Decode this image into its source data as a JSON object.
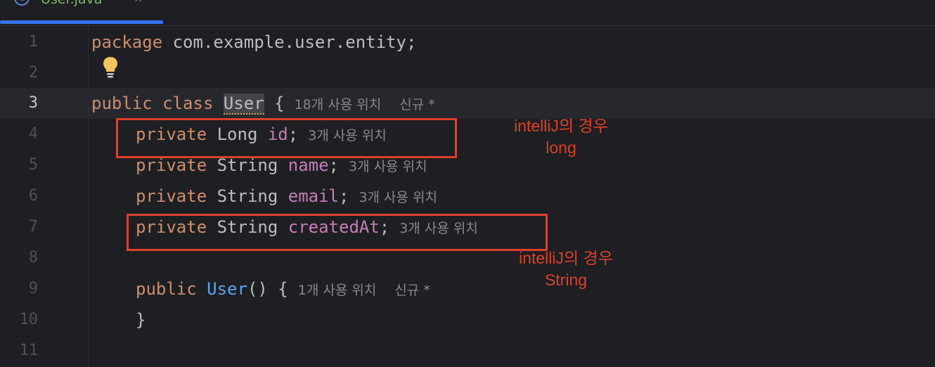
{
  "tab": {
    "label": "User.java",
    "close": "×",
    "icon_letter": "C",
    "accent": "#3574f0"
  },
  "editor": {
    "line_numbers": [
      "1",
      "2",
      "3",
      "4",
      "5",
      "6",
      "7",
      "8",
      "9",
      "10",
      "11"
    ],
    "current_line": "3",
    "lines": {
      "l1": {
        "kw": "package",
        "rest": " com.example.user.entity;"
      },
      "l3": {
        "kw1": "public",
        "kw2": "class",
        "cls": "User",
        "brace": " {",
        "hint": "18개 사용 위치",
        "hint2": "신규 *"
      },
      "l4": {
        "kw": "private",
        "type": " Long ",
        "field": "id",
        "semi": ";",
        "hint": "3개 사용 위치"
      },
      "l5": {
        "kw": "private",
        "type": " String ",
        "field": "name",
        "semi": ";",
        "hint": "3개 사용 위치"
      },
      "l6": {
        "kw": "private",
        "type": " String ",
        "field": "email",
        "semi": ";",
        "hint": "3개 사용 위치"
      },
      "l7": {
        "kw": "private",
        "type": " String ",
        "field": "createdAt",
        "semi": ";",
        "hint": "3개 사용 위치"
      },
      "l9": {
        "kw": "public",
        "fn": "User",
        "rest": "() {",
        "hint": "1개 사용 위치",
        "hint2": "신규 *"
      },
      "l10": {
        "rest": "}"
      }
    }
  },
  "annotations": {
    "note1": {
      "line1": "intelliJ의 경우",
      "line2": "long"
    },
    "note2": {
      "line1": "intelliJ의 경우",
      "line2": "String"
    },
    "color": "#e0402a"
  }
}
